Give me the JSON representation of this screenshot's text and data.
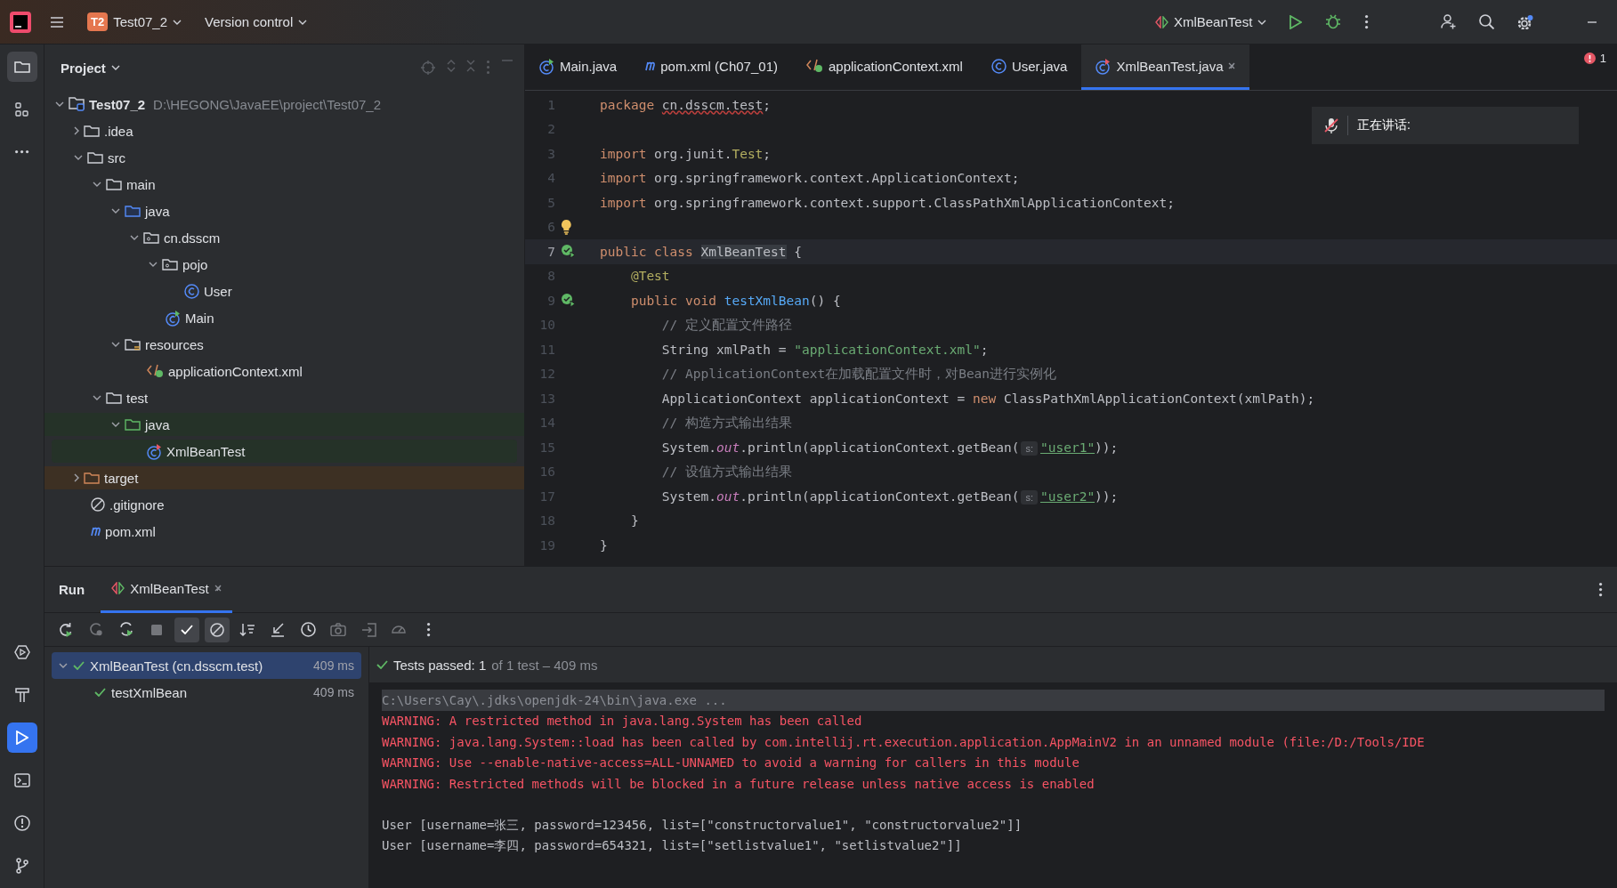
{
  "toolbar": {
    "project_badge": "T2",
    "project": "Test07_2",
    "vcs": "Version control",
    "run_config": "XmlBeanTest"
  },
  "side_tools_top": [
    {
      "kind": "folder",
      "selected": true
    },
    {
      "kind": "structure",
      "selected": false
    },
    {
      "kind": "more",
      "selected": false
    }
  ],
  "side_tools_bottom": [
    {
      "kind": "services",
      "selected": false
    },
    {
      "kind": "build",
      "selected": false
    },
    {
      "kind": "run",
      "selected": true
    },
    {
      "kind": "terminal",
      "selected": false
    },
    {
      "kind": "problems",
      "selected": false
    },
    {
      "kind": "git",
      "selected": false
    }
  ],
  "project_panel": {
    "title": "Project",
    "tree": [
      {
        "kind": "module",
        "label": "Test07_2",
        "path": "D:\\HEGONG\\JavaEE\\project\\Test07_2",
        "expanded": true,
        "selected": false,
        "children": [
          {
            "kind": "folder",
            "label": ".idea",
            "expanded": false,
            "selected": false
          },
          {
            "kind": "folder",
            "label": "src",
            "expanded": true,
            "selected": false,
            "children": [
              {
                "kind": "folder",
                "label": "main",
                "expanded": true,
                "selected": false,
                "children": [
                  {
                    "kind": "source",
                    "label": "java",
                    "expanded": true,
                    "selected": false,
                    "children": [
                      {
                        "kind": "package",
                        "label": "cn.dsscm",
                        "expanded": true,
                        "selected": false,
                        "children": [
                          {
                            "kind": "package",
                            "label": "pojo",
                            "expanded": true,
                            "selected": false,
                            "children": [
                              {
                                "kind": "class",
                                "label": "User",
                                "selected": false
                              }
                            ]
                          },
                          {
                            "kind": "main-class",
                            "label": "Main",
                            "selected": false
                          }
                        ]
                      }
                    ]
                  },
                  {
                    "kind": "resources",
                    "label": "resources",
                    "expanded": true,
                    "selected": false,
                    "children": [
                      {
                        "kind": "xml",
                        "label": "applicationContext.xml",
                        "selected": false
                      }
                    ]
                  }
                ]
              },
              {
                "kind": "folder",
                "label": "test",
                "expanded": true,
                "selected": false,
                "children": [
                  {
                    "kind": "test-source",
                    "label": "java",
                    "expanded": true,
                    "selected": false,
                    "children": [
                      {
                        "kind": "test-class",
                        "label": "XmlBeanTest",
                        "selected": true
                      }
                    ]
                  }
                ]
              }
            ]
          },
          {
            "kind": "excluded",
            "label": "target",
            "expanded": false,
            "selected": false
          },
          {
            "kind": "ignore",
            "label": ".gitignore",
            "selected": false
          },
          {
            "kind": "maven",
            "label": "pom.xml",
            "selected": false
          }
        ]
      }
    ]
  },
  "editor_tabs": [
    {
      "kind": "main-class",
      "label": "Main.java",
      "selected": false
    },
    {
      "kind": "maven",
      "label": "pom.xml (Ch07_01)",
      "selected": false
    },
    {
      "kind": "xml",
      "label": "applicationContext.xml",
      "selected": false
    },
    {
      "kind": "class",
      "label": "User.java",
      "selected": false
    },
    {
      "kind": "test-class",
      "label": "XmlBeanTest.java",
      "selected": true
    }
  ],
  "error_count": "1",
  "code": [
    {
      "n": "1",
      "tokens": [
        {
          "kind": "kw",
          "text": "package "
        },
        {
          "kind": "wavy",
          "text": "cn.dsscm.test"
        },
        {
          "kind": "plain",
          "text": ";"
        }
      ]
    },
    {
      "n": "2"
    },
    {
      "n": "3",
      "tokens": [
        {
          "kind": "kw",
          "text": "import "
        },
        {
          "kind": "plain",
          "text": "org.junit."
        },
        {
          "kind": "ann",
          "text": "Test"
        },
        {
          "kind": "plain",
          "text": ";"
        }
      ]
    },
    {
      "n": "4",
      "tokens": [
        {
          "kind": "kw",
          "text": "import "
        },
        {
          "kind": "plain",
          "text": "org.springframework.context.ApplicationContext;"
        }
      ]
    },
    {
      "n": "5",
      "tokens": [
        {
          "kind": "kw",
          "text": "import "
        },
        {
          "kind": "plain",
          "text": "org.springframework.context.support.ClassPathXmlApplicationContext;"
        }
      ]
    },
    {
      "n": "6",
      "kind": "bulb"
    },
    {
      "n": "7",
      "kind": "run",
      "current": true,
      "tokens": [
        {
          "kind": "kw",
          "text": "public class "
        },
        {
          "kind": "hl",
          "text": "XmlBeanTest"
        },
        {
          "kind": "plain",
          "text": " {"
        }
      ]
    },
    {
      "n": "8",
      "tokens": [
        {
          "kind": "ann",
          "text": "    @Test"
        }
      ]
    },
    {
      "n": "9",
      "kind": "run",
      "tokens": [
        {
          "kind": "kw",
          "text": "    public void "
        },
        {
          "kind": "fn",
          "text": "testXmlBean"
        },
        {
          "kind": "plain",
          "text": "() {"
        }
      ]
    },
    {
      "n": "10",
      "tokens": [
        {
          "kind": "cmt",
          "text": "        // 定义配置文件路径"
        }
      ]
    },
    {
      "n": "11",
      "tokens": [
        {
          "kind": "plain",
          "text": "        String xmlPath = "
        },
        {
          "kind": "str",
          "text": "\"applicationContext.xml\""
        },
        {
          "kind": "plain",
          "text": ";"
        }
      ]
    },
    {
      "n": "12",
      "tokens": [
        {
          "kind": "cmt",
          "text": "        // ApplicationContext在加载配置文件时，对Bean进行实例化"
        }
      ]
    },
    {
      "n": "13",
      "tokens": [
        {
          "kind": "plain",
          "text": "        ApplicationContext applicationContext = "
        },
        {
          "kind": "kw",
          "text": "new "
        },
        {
          "kind": "plain",
          "text": "ClassPathXmlApplicationContext(xmlPath);"
        }
      ]
    },
    {
      "n": "14",
      "tokens": [
        {
          "kind": "cmt",
          "text": "        // 构造方式输出结果"
        }
      ]
    },
    {
      "n": "15",
      "tokens": [
        {
          "kind": "plain",
          "text": "        System."
        },
        {
          "kind": "field",
          "text": "out"
        },
        {
          "kind": "plain",
          "text": ".println(applicationContext.getBean("
        },
        {
          "kind": "hint",
          "text": "s:"
        },
        {
          "kind": "link",
          "text": "\"user1\""
        },
        {
          "kind": "plain",
          "text": "));"
        }
      ]
    },
    {
      "n": "16",
      "tokens": [
        {
          "kind": "cmt",
          "text": "        // 设值方式输出结果"
        }
      ]
    },
    {
      "n": "17",
      "tokens": [
        {
          "kind": "plain",
          "text": "        System."
        },
        {
          "kind": "field",
          "text": "out"
        },
        {
          "kind": "plain",
          "text": ".println(applicationContext.getBean("
        },
        {
          "kind": "hint",
          "text": "s:"
        },
        {
          "kind": "link",
          "text": "\"user2\""
        },
        {
          "kind": "plain",
          "text": "));"
        }
      ]
    },
    {
      "n": "18",
      "tokens": [
        {
          "kind": "plain",
          "text": "    }"
        }
      ]
    },
    {
      "n": "19",
      "tokens": [
        {
          "kind": "plain",
          "text": "}"
        }
      ]
    }
  ],
  "speaking_overlay": {
    "label": "正在讲话:"
  },
  "run_panel": {
    "title": "Run",
    "tab": "XmlBeanTest",
    "tools": [
      {
        "kind": "rerun",
        "disabled": false,
        "selected": false
      },
      {
        "kind": "rerun-failed",
        "disabled": true,
        "selected": false
      },
      {
        "kind": "toggle-rerun",
        "disabled": false,
        "selected": false
      },
      {
        "kind": "stop",
        "disabled": true,
        "selected": false
      },
      {
        "kind": "passed",
        "disabled": false,
        "selected": true
      },
      {
        "kind": "ignored",
        "disabled": false,
        "selected": true
      },
      {
        "kind": "sort",
        "disabled": false,
        "selected": false
      },
      {
        "kind": "collapse",
        "disabled": false,
        "selected": false
      },
      {
        "kind": "history",
        "disabled": false,
        "selected": false
      },
      {
        "kind": "camera",
        "disabled": true,
        "selected": false
      },
      {
        "kind": "import",
        "disabled": true,
        "selected": false
      },
      {
        "kind": "gauge",
        "disabled": true,
        "selected": false
      },
      {
        "kind": "more",
        "disabled": false,
        "selected": false
      }
    ],
    "tests": [
      {
        "name": "XmlBeanTest (cn.dsscm.test)",
        "time": "409 ms",
        "expanded": true,
        "selected": true,
        "children": [
          {
            "name": "testXmlBean",
            "time": "409 ms",
            "selected": false
          }
        ]
      }
    ],
    "status": "Tests passed: 1",
    "status_detail": "of 1 test – 409 ms",
    "console": [
      {
        "kind": "command",
        "text": "C:\\Users\\Cay\\.jdks\\openjdk-24\\bin\\java.exe ..."
      },
      {
        "kind": "warning",
        "text": "WARNING: A restricted method in java.lang.System has been called"
      },
      {
        "kind": "warning",
        "text": "WARNING: java.lang.System::load has been called by com.intellij.rt.execution.application.AppMainV2 in an unnamed module (file:/D:/Tools/IDE"
      },
      {
        "kind": "warning",
        "text": "WARNING: Use --enable-native-access=ALL-UNNAMED to avoid a warning for callers in this module"
      },
      {
        "kind": "warning",
        "text": "WARNING: Restricted methods will be blocked in a future release unless native access is enabled"
      },
      {
        "kind": "blank"
      },
      {
        "kind": "output",
        "text": "User [username=张三, password=123456, list=[\"constructorvalue1\", \"constructorvalue2\"]]"
      },
      {
        "kind": "output",
        "text": "User [username=李四, password=654321, list=[\"setlistvalue1\", \"setlistvalue2\"]]"
      }
    ]
  }
}
